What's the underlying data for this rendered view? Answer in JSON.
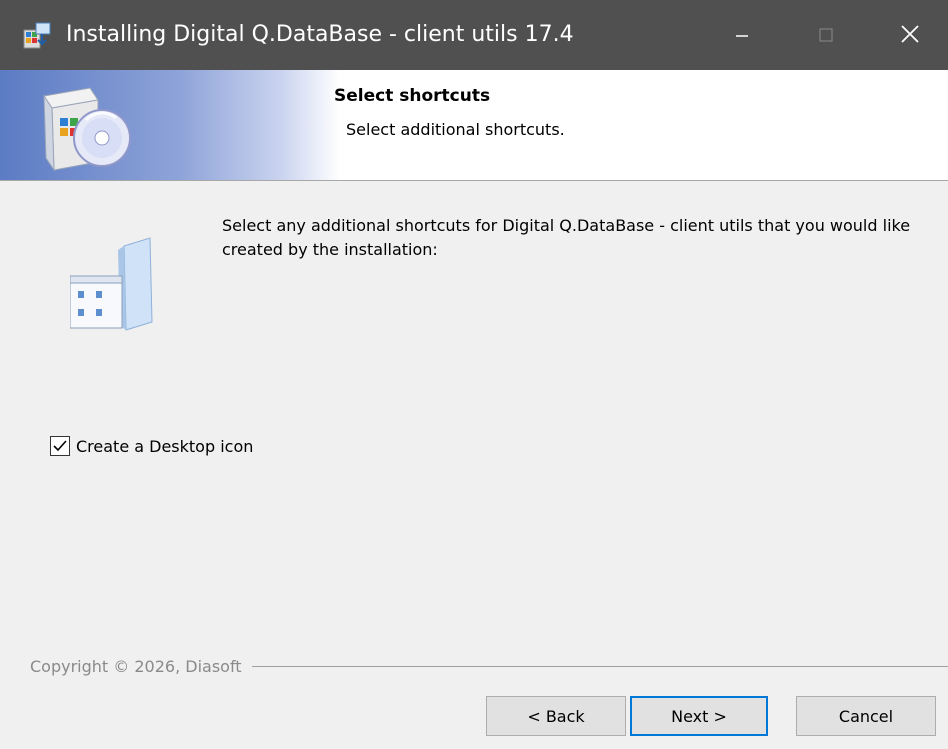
{
  "window": {
    "title": "Installing Digital Q.DataBase - client utils 17.4",
    "icons": {
      "app": "installer-icon",
      "minimize": "minimize-icon",
      "maximize": "maximize-icon",
      "close": "close-icon"
    }
  },
  "banner": {
    "heading": "Select shortcuts",
    "subheading": "Select additional shortcuts.",
    "icon": "setup-box-cd-icon"
  },
  "main": {
    "intro": "Select any additional shortcuts for Digital Q.DataBase - client utils that you would like created by the installation:",
    "icon": "shortcuts-folder-icon",
    "desktop_icon_label": "Create a Desktop icon",
    "desktop_icon_checked": true
  },
  "footer": {
    "copyright": "Copyright © 2026, Diasoft",
    "back_label": "< Back",
    "next_label": "Next >",
    "cancel_label": "Cancel"
  },
  "colors": {
    "titlebar": "#505050",
    "banner_gradient_start": "#5b7bc4",
    "focus_border": "#0078d7"
  }
}
